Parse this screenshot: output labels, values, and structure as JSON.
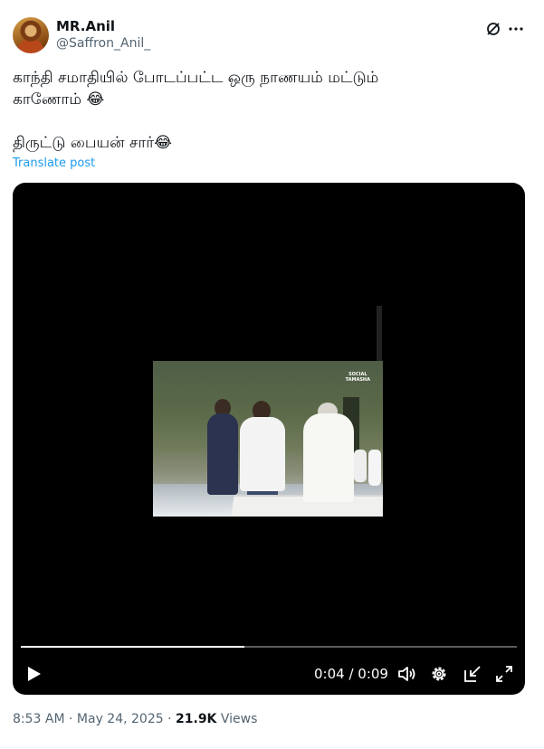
{
  "author": {
    "name": "MR.Anil",
    "handle": "@Saffron_Anil_"
  },
  "tweet": {
    "text": "காந்தி சமாதியில் போடப்பட்ட ஒரு நாணயம் மட்டும்\nகாணோம் 😂\n\n திருட்டு பையன் சார்😂",
    "translate_label": "Translate post"
  },
  "video": {
    "watermark_line1": "SOCIAL",
    "watermark_line2": "TAMASHA",
    "current_time": "0:04",
    "duration": "0:09",
    "time_display": "0:04 / 0:09",
    "progress": 0.45
  },
  "meta": {
    "time": "8:53 AM",
    "date": "May 24, 2025",
    "views_count": "21.9K",
    "views_label": "Views"
  },
  "icons": [
    "grok-icon",
    "more-icon",
    "play-icon",
    "volume-icon",
    "settings-icon",
    "pip-icon",
    "fullscreen-icon"
  ]
}
